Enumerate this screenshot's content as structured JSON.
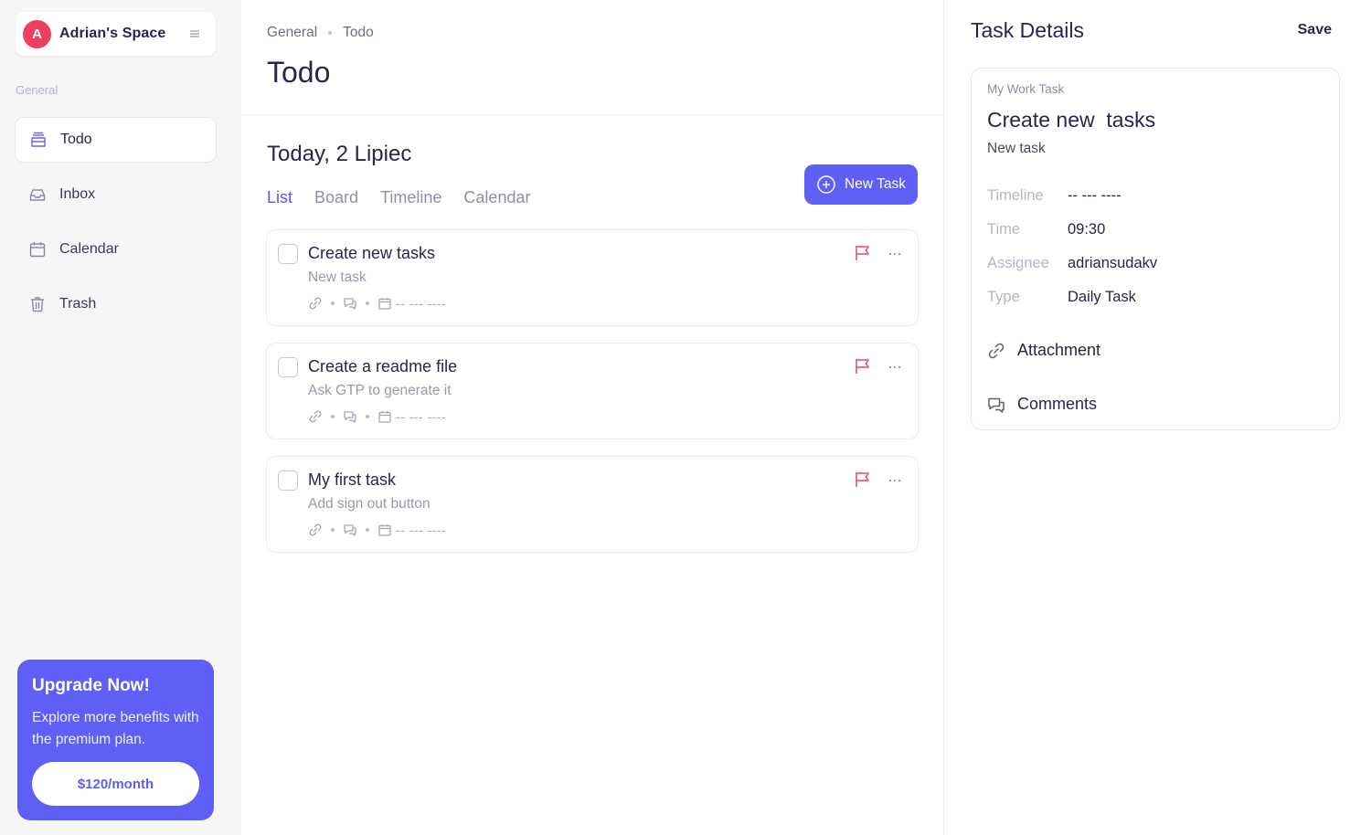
{
  "sidebar": {
    "workspace": {
      "initial": "A",
      "name": "Adrian's Space"
    },
    "section": "General",
    "items": [
      {
        "label": "Todo",
        "icon": "archive-box-icon"
      },
      {
        "label": "Inbox",
        "icon": "inbox-icon"
      },
      {
        "label": "Calendar",
        "icon": "calendar-icon"
      },
      {
        "label": "Trash",
        "icon": "trash-icon"
      }
    ],
    "upgrade": {
      "title": "Upgrade Now!",
      "text": "Explore more benefits with the premium plan.",
      "button": "$120/month"
    }
  },
  "main": {
    "breadcrumb": [
      "General",
      "Todo"
    ],
    "title": "Todo",
    "date_heading": "Today, 2 Lipiec",
    "tabs": [
      "List",
      "Board",
      "Timeline",
      "Calendar"
    ],
    "active_tab": "List",
    "new_task_label": "New Task",
    "tasks": [
      {
        "title": "Create new tasks",
        "subtitle": "New task",
        "date": "-- --- ----"
      },
      {
        "title": "Create a readme file",
        "subtitle": "Ask GTP to generate it",
        "date": "-- --- ----"
      },
      {
        "title": "My first task",
        "subtitle": "Add sign out button",
        "date": "-- --- ----"
      }
    ]
  },
  "details": {
    "title": "Task Details",
    "save_label": "Save",
    "project": "My Work Task",
    "task_title": "Create new  tasks",
    "task_subtitle": "New task",
    "fields": [
      {
        "label": "Timeline",
        "value": "-- --- ----"
      },
      {
        "label": "Time",
        "value": "09:30"
      },
      {
        "label": "Assignee",
        "value": "adriansudakv"
      },
      {
        "label": "Type",
        "value": "Daily Task"
      }
    ],
    "attachment_label": "Attachment",
    "comments_label": "Comments"
  },
  "colors": {
    "accent": "#5f5ff6",
    "avatar": "#ee3f5f",
    "flag": "#ee4466",
    "sidebar_bg": "#f6f6f7",
    "text_dark": "#2b2450"
  }
}
